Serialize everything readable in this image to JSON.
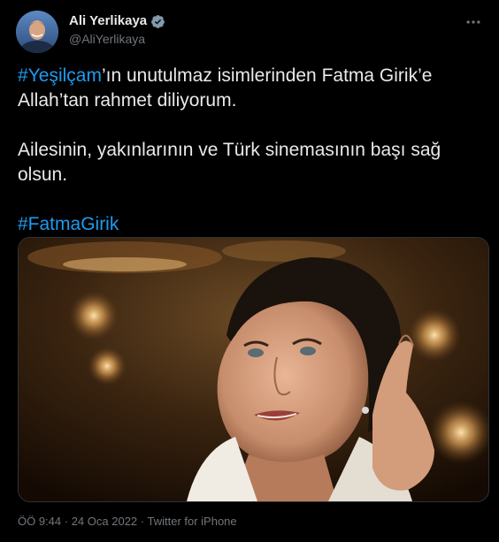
{
  "author": {
    "display_name": "Ali Yerlikaya",
    "handle": "@AliYerlikaya",
    "verified_icon": "verified-badge-icon",
    "avatar_icon": "avatar"
  },
  "menu": {
    "icon": "more-options-icon"
  },
  "tweet": {
    "hashtag1": "#Yeşilçam",
    "line1_rest": "’ın unutulmaz isimlerinden Fatma Girik’e",
    "line2": "Allah’tan rahmet diliyorum.",
    "line3": "Ailesinin, yakınlarının ve Türk sinemasının başı sağ",
    "line4": "olsun.",
    "hashtag2": "#FatmaGirik"
  },
  "media": {
    "type": "photo"
  },
  "meta": {
    "time": "ÖÖ 9:44",
    "sep1": " · ",
    "date": "24 Oca 2022",
    "sep2": " · ",
    "source": "Twitter for iPhone"
  },
  "colors": {
    "background": "#000000",
    "text": "#e7e9ea",
    "secondary": "#71767b",
    "link": "#1d9bf0",
    "verified": "#829aab"
  }
}
